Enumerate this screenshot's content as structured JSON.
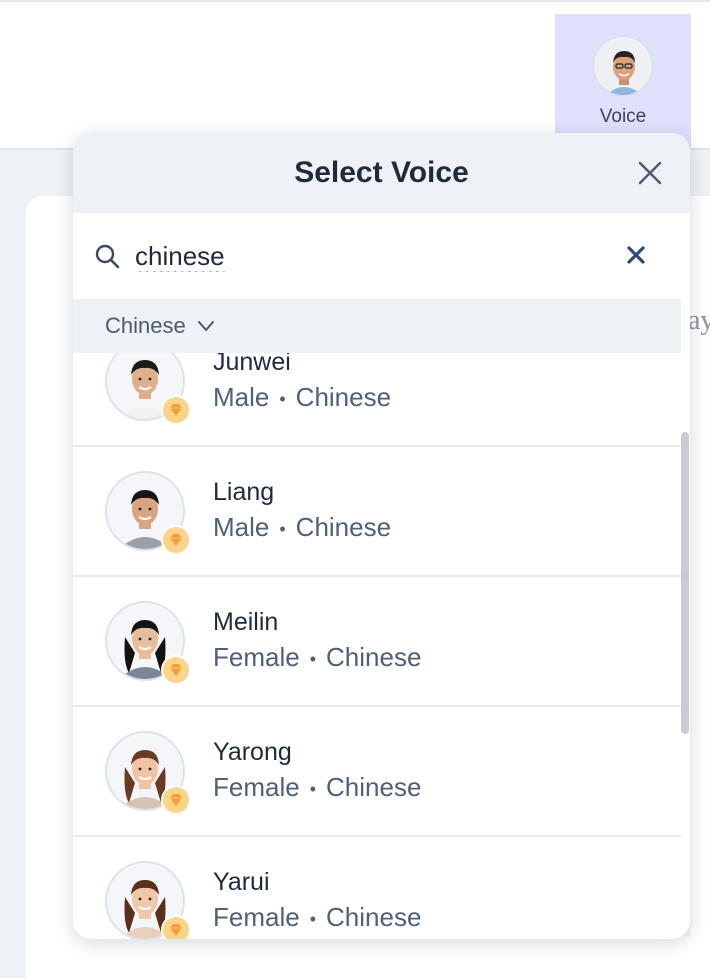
{
  "toolbar": {
    "voice_label": "Voice",
    "voice_avatar_icon": "person-avatar-icon"
  },
  "background": {
    "partial_text": "ay"
  },
  "popup": {
    "title": "Select Voice",
    "close_icon": "close-icon",
    "search": {
      "value": "chinese",
      "icon": "search-icon",
      "clear_icon": "clear-x-icon"
    },
    "filter": {
      "label": "Chinese",
      "icon": "chevron-down-icon"
    },
    "voices": [
      {
        "name": "Junwei",
        "gender": "Male",
        "language": "Chinese",
        "premium": true
      },
      {
        "name": "Liang",
        "gender": "Male",
        "language": "Chinese",
        "premium": true
      },
      {
        "name": "Meilin",
        "gender": "Female",
        "language": "Chinese",
        "premium": true
      },
      {
        "name": "Yarong",
        "gender": "Female",
        "language": "Chinese",
        "premium": true
      },
      {
        "name": "Yarui",
        "gender": "Female",
        "language": "Chinese",
        "premium": true
      }
    ],
    "separator": "•"
  },
  "colors": {
    "accent_tab": "#dfe0fb",
    "premium_badge": "#fbd48a",
    "premium_gem": "#f0a03a",
    "spellcheck_underline": "#e0543e"
  }
}
